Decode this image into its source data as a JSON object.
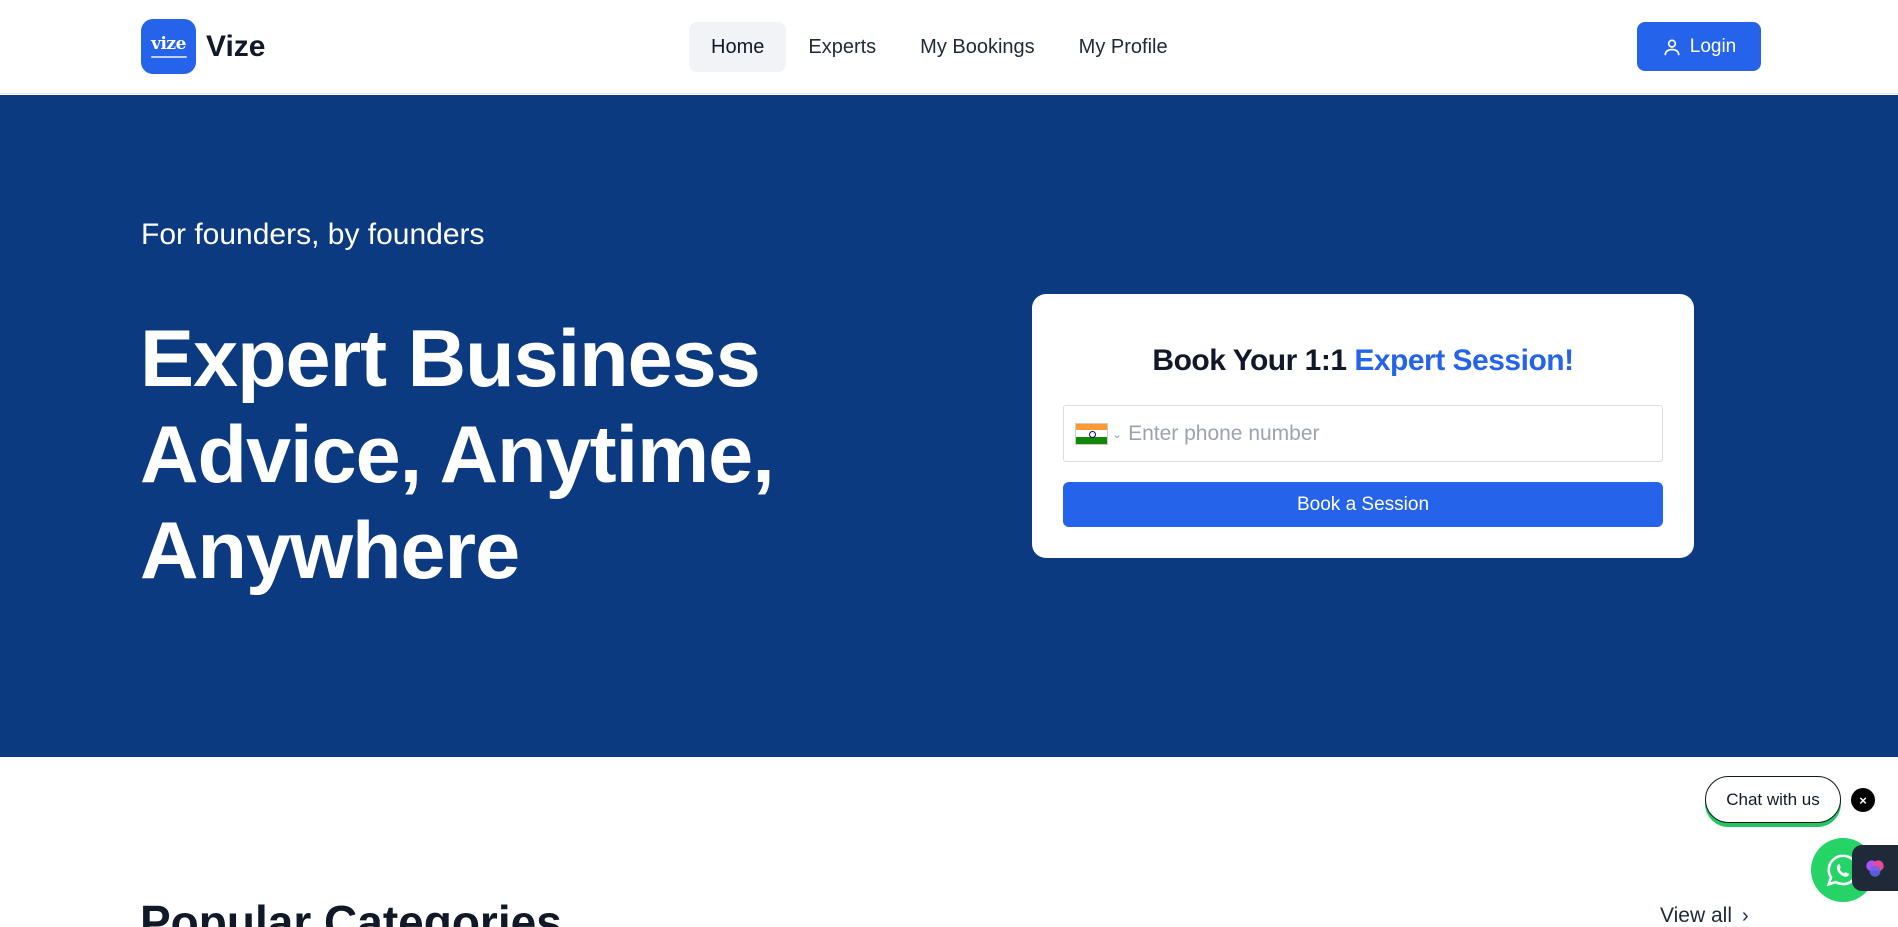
{
  "header": {
    "logo_text": "vize",
    "brand": "Vize",
    "nav": [
      {
        "label": "Home",
        "active": true
      },
      {
        "label": "Experts",
        "active": false
      },
      {
        "label": "My Bookings",
        "active": false
      },
      {
        "label": "My Profile",
        "active": false
      }
    ],
    "login_label": "Login"
  },
  "hero": {
    "tagline": "For founders, by founders",
    "title": "Expert Business Advice, Anytime, Anywhere",
    "card": {
      "title_prefix": "Book Your 1:1 ",
      "title_accent": "Expert Session!",
      "phone_placeholder": "Enter phone number",
      "phone_value": "",
      "country_flag": "india-flag-icon",
      "book_label": "Book a Session"
    }
  },
  "categories": {
    "title": "Popular Categories",
    "view_all": "View all"
  },
  "widgets": {
    "chat_label": "Chat with us",
    "close_glyph": "×"
  },
  "colors": {
    "primary": "#2563eb",
    "hero_bg": "#0b3a80",
    "whatsapp": "#25d366"
  }
}
